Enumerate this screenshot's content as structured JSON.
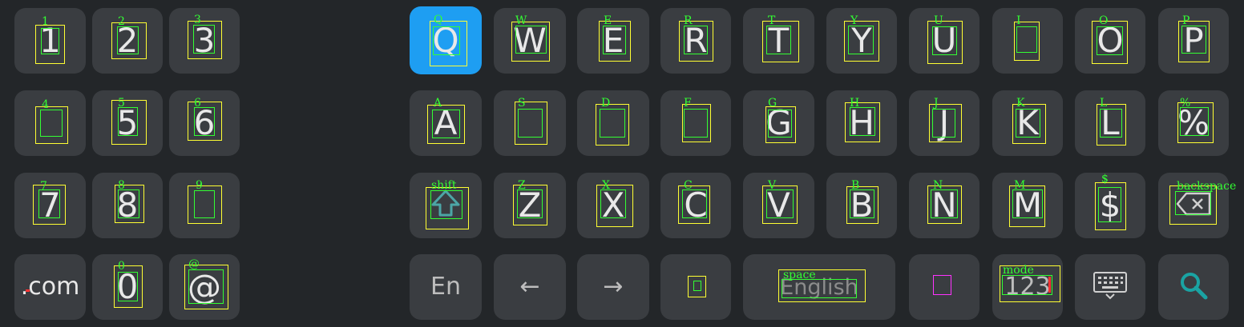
{
  "numpad": {
    "row1": [
      "1",
      "2",
      "3"
    ],
    "row2": [
      "",
      "5",
      "6"
    ],
    "row3": [
      "7",
      "8",
      ""
    ],
    "row4": [
      ".com",
      "0",
      "@"
    ]
  },
  "qwerty_row": [
    "Q",
    "W",
    "E",
    "R",
    "T",
    "Y",
    "U",
    "",
    "O",
    "P"
  ],
  "asdf_row": [
    "A",
    "",
    "",
    "",
    "G",
    "H",
    "J",
    "K",
    "L",
    "%"
  ],
  "zxcv_row": [
    "Z",
    "X",
    "C",
    "V",
    "B",
    "N",
    "M",
    "$"
  ],
  "bottom_row": {
    "lang": "En",
    "left_arrow": "←",
    "right_arrow": "→",
    "space": "English",
    "mode": "123"
  },
  "annotations": {
    "numpad": [
      "1",
      "2",
      "3",
      "4",
      "5",
      "6",
      "7",
      "8",
      "9",
      "",
      "0",
      "@"
    ],
    "qwerty": [
      "Q",
      "W",
      "E",
      "R",
      "T",
      "Y",
      "U",
      "I",
      "O",
      "P"
    ],
    "asdf": [
      "A",
      "S",
      "D",
      "F",
      "G",
      "H",
      "J",
      "K",
      "L",
      "%"
    ],
    "zxcv": [
      "shift",
      "Z",
      "X",
      "C",
      "V",
      "B",
      "N",
      "M",
      "$",
      "backspace"
    ],
    "bottom": [
      "space",
      "mode"
    ]
  },
  "colors": {
    "background": "#232629",
    "key": "#3a3d41",
    "active_key": "#1e9ef2",
    "outer_box": "#ffff33",
    "inner_box": "#33ff33",
    "search_icon": "#1aa3a3"
  },
  "icons": {
    "shift": "shift-icon",
    "backspace": "backspace-icon",
    "hide_keyboard": "keyboard-hide-icon",
    "search": "search-icon"
  }
}
